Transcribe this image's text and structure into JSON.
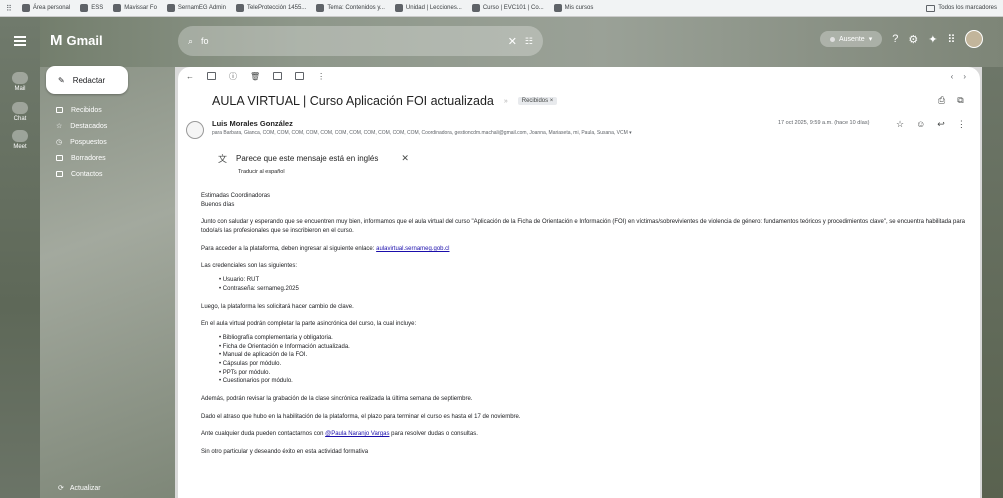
{
  "bookmarks": {
    "items": [
      "Área personal",
      "ESS",
      "Mavissar Fo",
      "SernamEG Admin",
      "TeleProtección 1455...",
      "Tema: Contenidos y...",
      "Unidad | Lecciones...",
      "Curso | EVC101 | Co...",
      "Mis cursos"
    ],
    "all_label": "Todos los marcadores"
  },
  "gmail": {
    "logo": "Gmail",
    "search_value": "fo",
    "status": "Ausente"
  },
  "rail": [
    "Mail",
    "Chat",
    "Meet"
  ],
  "sidebar": {
    "compose": "Redactar",
    "items": [
      "Recibidos",
      "Destacados",
      "Pospuestos",
      "Borradores",
      "Contactos"
    ],
    "footer": "Actualizar"
  },
  "message": {
    "subject": "AULA VIRTUAL | Curso Aplicación FOI actualizada",
    "label": "Recibidos ×",
    "sender": "Luis Morales González",
    "recipients": "para Barbara, Gianca, COM, COM, COM, COM, COM, COM, COM, COM, COM, COM, COM, Coordinadora, gestioncdm.machali@gmail.com, Joanna, Mariaseta, mi, Paula, Susana, VCM ▾",
    "date": "17 oct 2025, 9:59 a.m. (hace 10 días)",
    "lang_notice": "Parece que este mensaje está en inglés",
    "translate": "Traducir al español",
    "greeting": "Estimadas Coordinadoras",
    "greeting2": "Buenos días",
    "p1": "Junto con saludar y esperando que se encuentren muy bien, informamos que el aula virtual del curso \"Aplicación de la Ficha de Orientación e Información (FOI) en víctimas/sobrevivientes de violencia de género: fundamentos teóricos y procedimientos clave\", se encuentra habilitada para todo/a/s las profesionales que se inscribieron en el curso.",
    "p2": "Para acceder a la plataforma, deben ingresar al siguiente enlace:",
    "p2_link": "aulavirtual.sernameg.gob.cl",
    "p3": "Las credenciales son las siguientes:",
    "credentials": [
      "Usuario: RUT",
      "Contraseña: sernameg.2025"
    ],
    "p4": "Luego, la plataforma les solicitará hacer cambio de clave.",
    "p5": "En el aula virtual podrán completar la parte asincrónica del curso, la cual incluye:",
    "includes": [
      "Bibliografía complementaria y obligatoria.",
      "Ficha de Orientación e Información actualizada.",
      "Manual de aplicación de la FOI.",
      "Cápsulas por módulo.",
      "PPTs por módulo.",
      "Cuestionarios por módulo."
    ],
    "p6": "Además, podrán revisar la grabación de la clase sincrónica realizada la última semana de septiembre.",
    "p7": "Dado el atraso que hubo en la habilitación de la plataforma, el plazo para terminar el curso es hasta el 17 de noviembre.",
    "p8a": "Ante cualquier duda pueden contactarnos con",
    "p8_link": "@Paula Naranjo Vargas",
    "p8b": "para resolver dudas o consultas.",
    "p9": "Sin otro particular y deseando éxito en esta actividad formativa"
  }
}
